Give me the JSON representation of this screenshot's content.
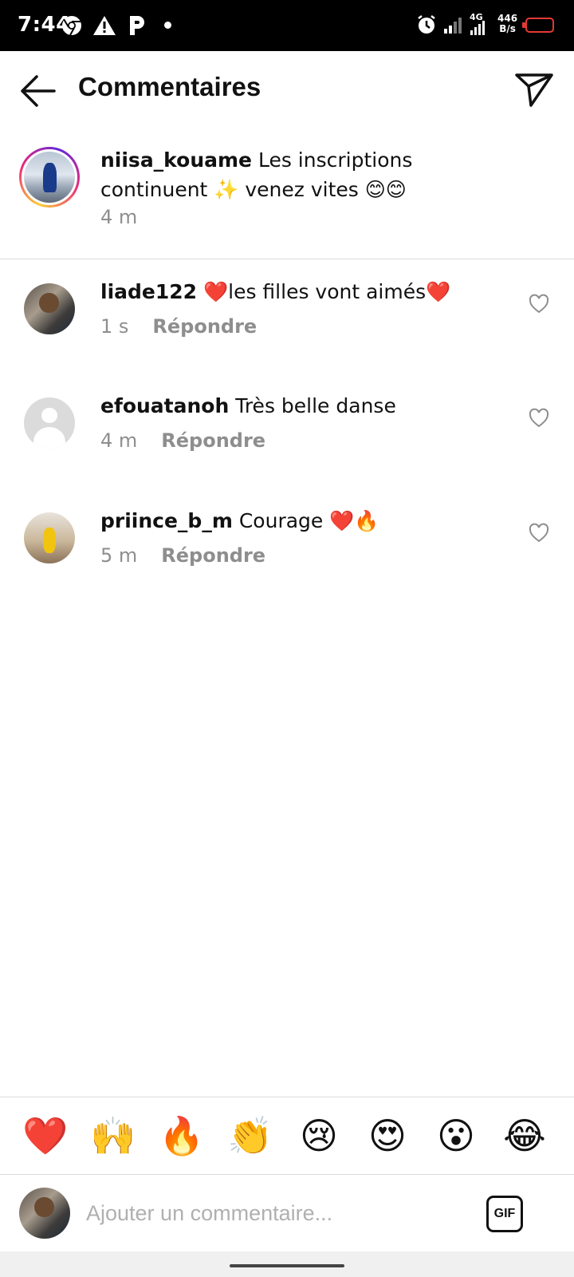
{
  "status_bar": {
    "time": "7:44",
    "network": "4G",
    "speed_value": "446",
    "speed_unit": "B/s",
    "battery_color": "#e53935"
  },
  "header": {
    "title": "Commentaires",
    "back_icon": "arrow-left-icon",
    "share_icon": "paper-plane-icon"
  },
  "caption": {
    "username": "niisa_kouame",
    "text": "Les inscriptions continuent ✨ venez vites 😊😊",
    "time": "4 m"
  },
  "comments": [
    {
      "username": "liade122",
      "text": "❤️les filles vont aimés❤️",
      "time": "1 s",
      "reply": "Répondre"
    },
    {
      "username": "efouatanoh",
      "text": "Très belle danse",
      "time": "4 m",
      "reply": "Répondre"
    },
    {
      "username": "priince_b_m",
      "text": "Courage ❤️🔥",
      "time": "5 m",
      "reply": "Répondre"
    }
  ],
  "emoji_bar": [
    "❤️",
    "🙌",
    "🔥",
    "👏",
    "😢",
    "😍",
    "😮",
    "😂"
  ],
  "input": {
    "placeholder": "Ajouter un commentaire...",
    "gif_label": "GIF"
  }
}
